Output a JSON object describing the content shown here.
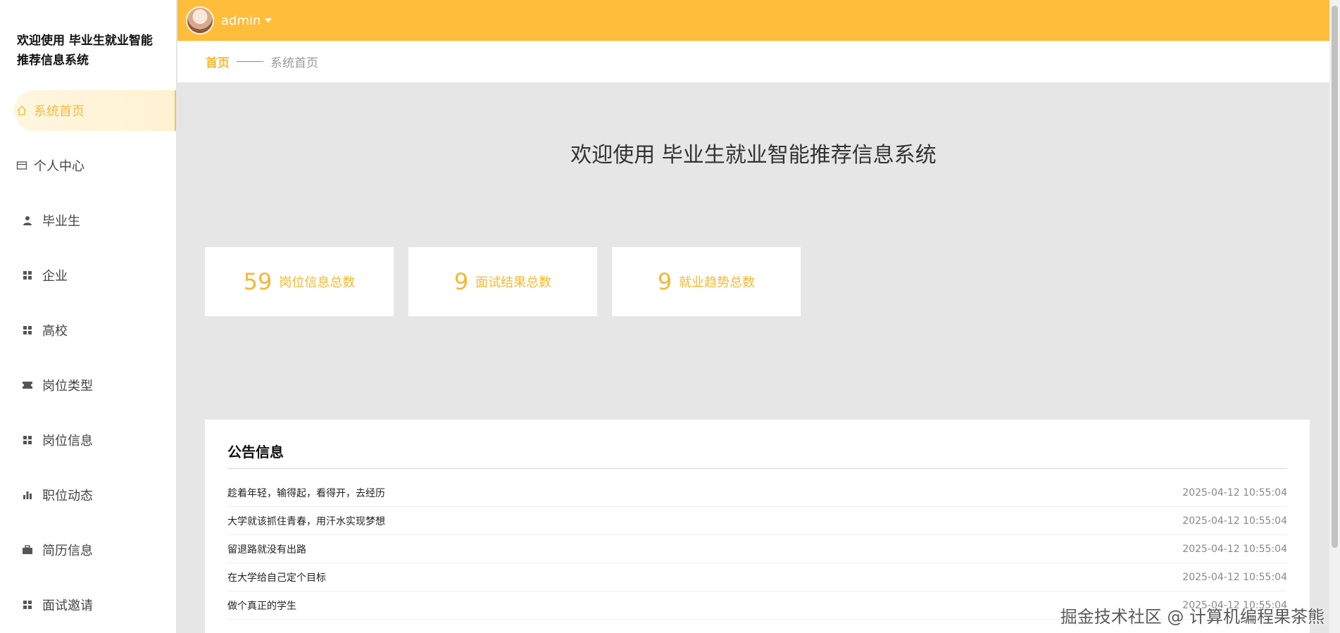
{
  "sidebar": {
    "title": "欢迎使用 毕业生就业智能推荐信息系统",
    "items": [
      {
        "label": "系统首页",
        "icon": "home-icon"
      },
      {
        "label": "个人中心",
        "icon": "card-icon"
      },
      {
        "label": "毕业生",
        "icon": "user-icon"
      },
      {
        "label": "企业",
        "icon": "grid-icon"
      },
      {
        "label": "高校",
        "icon": "grid-icon"
      },
      {
        "label": "岗位类型",
        "icon": "ticket-icon"
      },
      {
        "label": "岗位信息",
        "icon": "grid-icon"
      },
      {
        "label": "职位动态",
        "icon": "bar-chart-icon"
      },
      {
        "label": "简历信息",
        "icon": "briefcase-icon"
      },
      {
        "label": "面试邀请",
        "icon": "grid-icon"
      }
    ]
  },
  "header": {
    "username": "admin",
    "accent": "#ffbd3c"
  },
  "breadcrumb": {
    "home": "首页",
    "current": "系统首页"
  },
  "main": {
    "welcome": "欢迎使用 毕业生就业智能推荐信息系统",
    "stats": [
      {
        "value": "59",
        "label": "岗位信息总数"
      },
      {
        "value": "9",
        "label": "面试结果总数"
      },
      {
        "value": "9",
        "label": "就业趋势总数"
      }
    ],
    "notice": {
      "title": "公告信息",
      "rows": [
        {
          "text": "趁着年轻，输得起，看得开，去经历",
          "date": "2025-04-12 10:55:04"
        },
        {
          "text": "大学就该抓住青春，用汗水实现梦想",
          "date": "2025-04-12 10:55:04"
        },
        {
          "text": "留退路就没有出路",
          "date": "2025-04-12 10:55:04"
        },
        {
          "text": "在大学给自己定个目标",
          "date": "2025-04-12 10:55:04"
        },
        {
          "text": "做个真正的学生",
          "date": "2025-04-12 10:55:04"
        }
      ]
    }
  },
  "watermark": "掘金技术社区 @ 计算机编程果茶熊"
}
